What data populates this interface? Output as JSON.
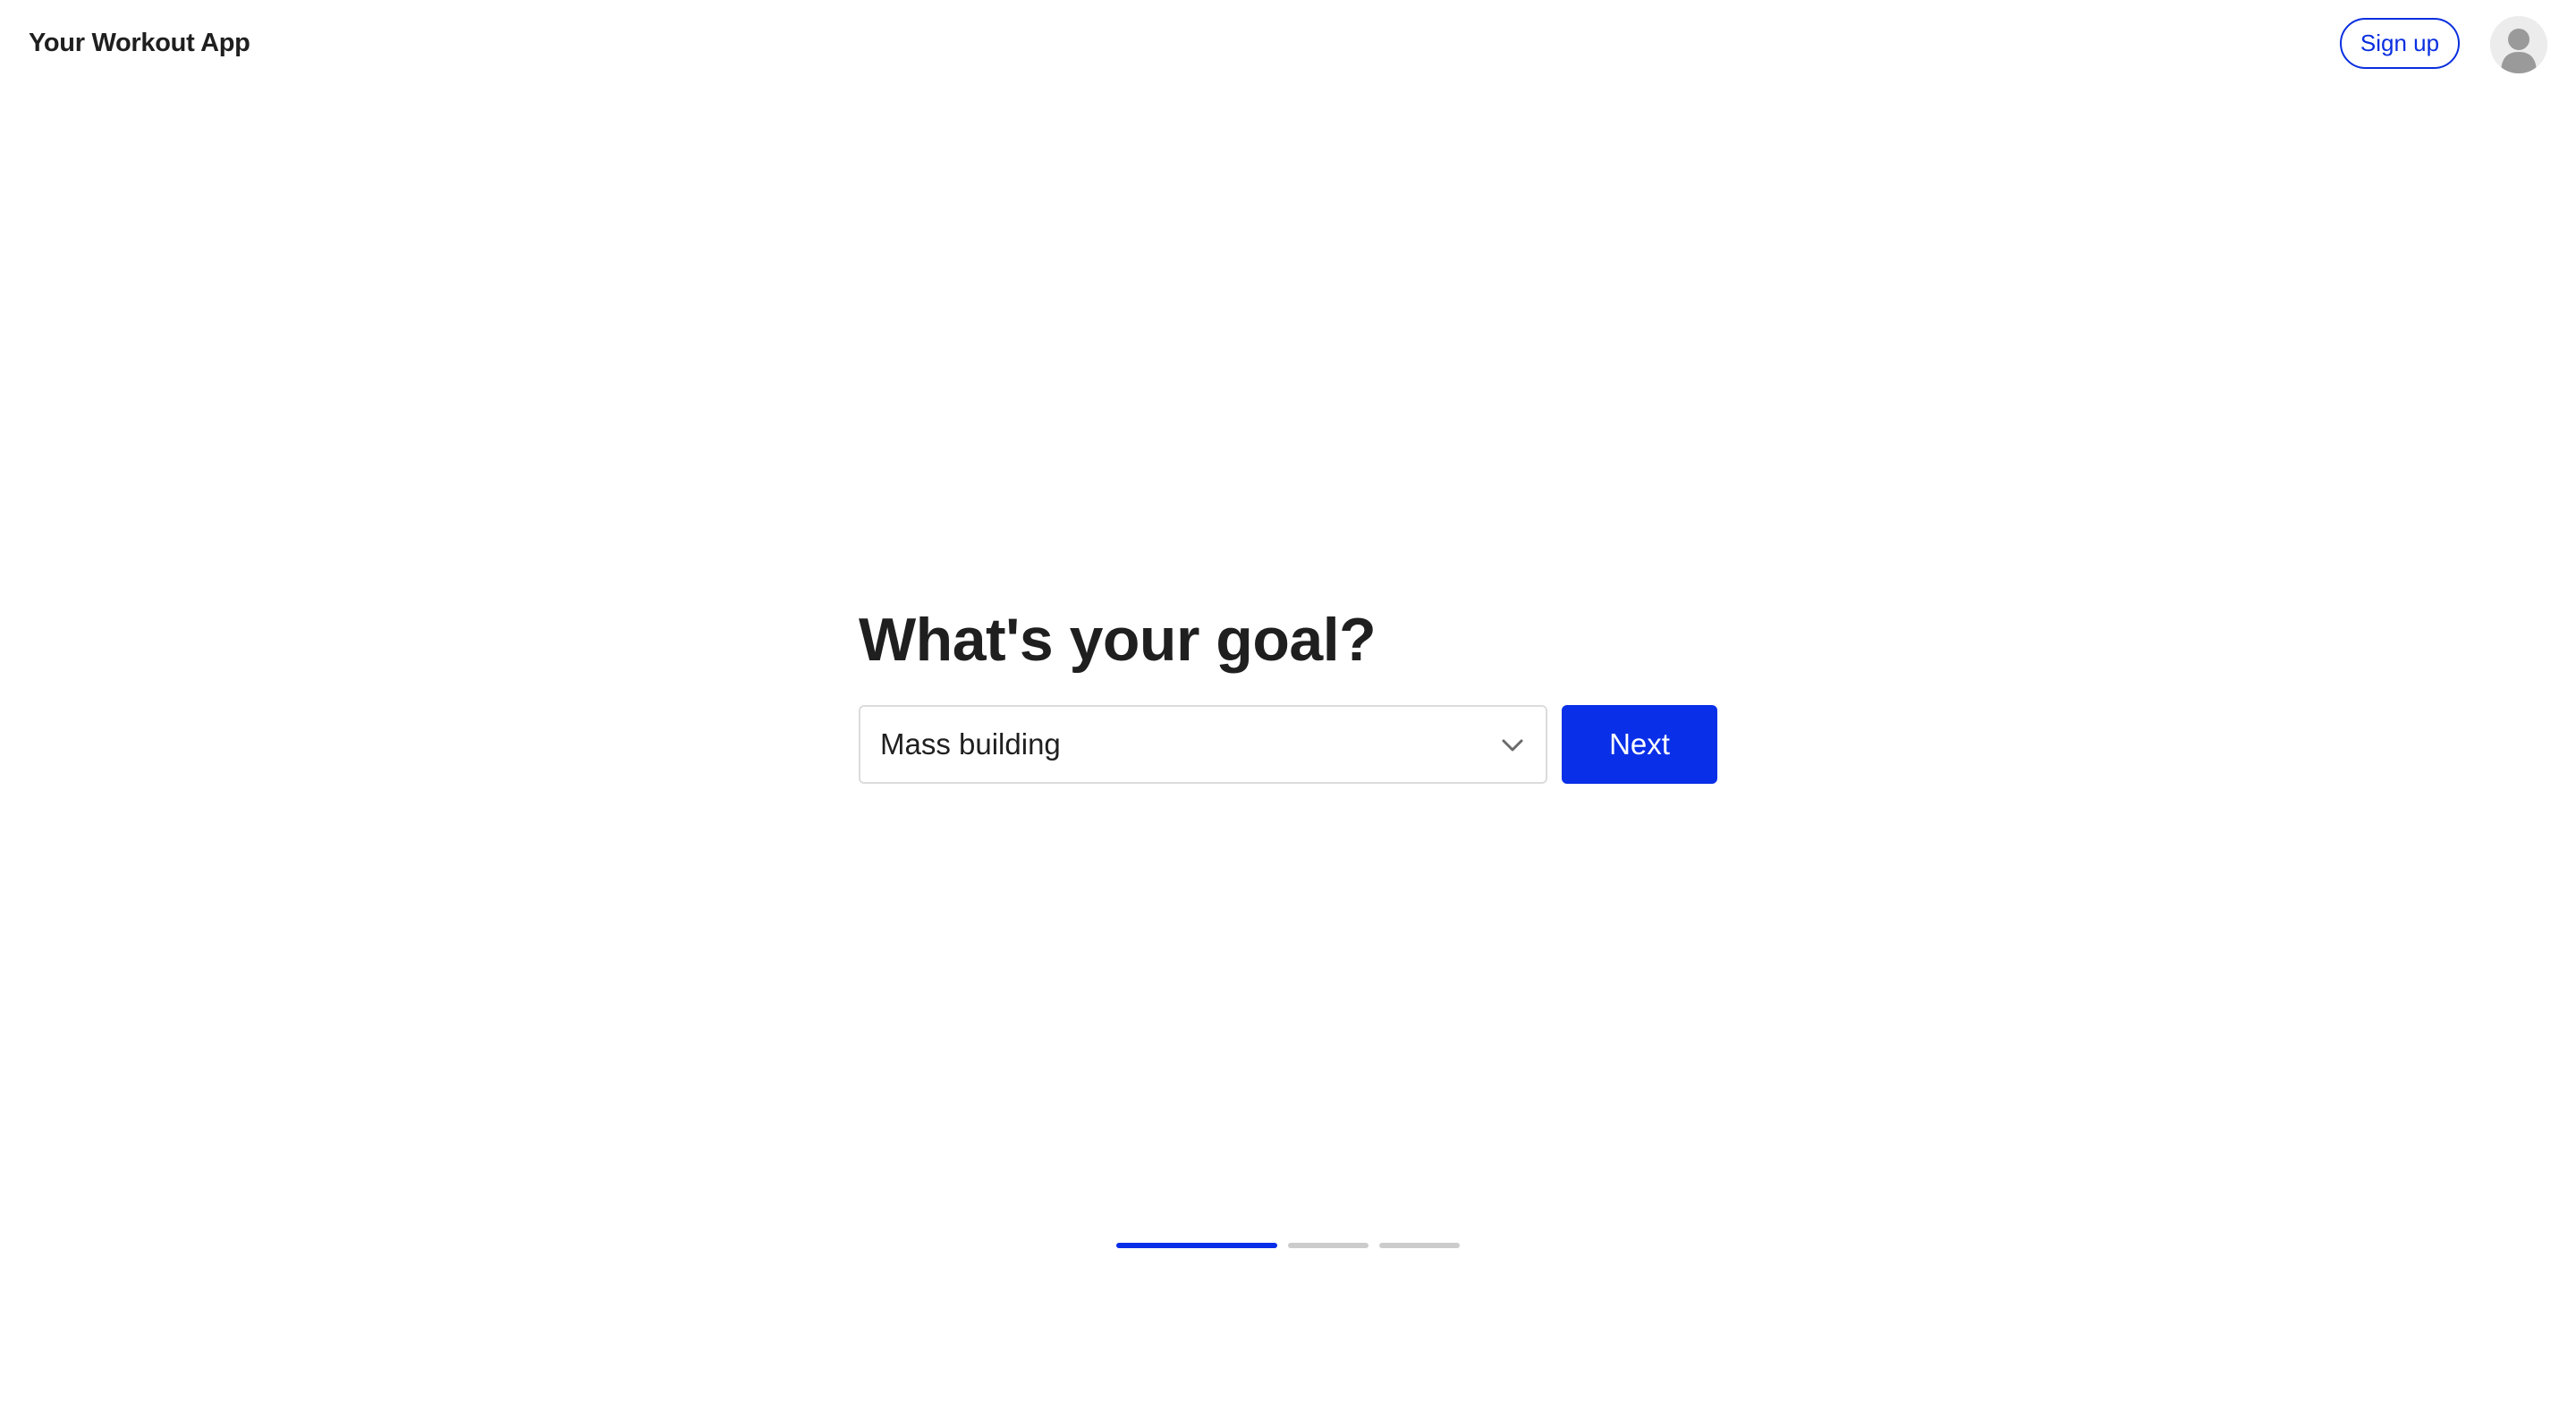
{
  "header": {
    "app_title": "Your Workout App",
    "signup_label": "Sign up",
    "avatar_icon": "user-avatar-icon"
  },
  "main": {
    "title": "What's your goal?",
    "goal_select": {
      "selected": "Mass building",
      "icon": "chevron-down-icon"
    },
    "next_label": "Next"
  },
  "progress": {
    "current_step": 1,
    "total_steps": 3
  },
  "colors": {
    "accent": "#0a2fe8",
    "text": "#1f1f1f",
    "inactive_step": "#cccccc",
    "border": "#dcdcdc"
  }
}
